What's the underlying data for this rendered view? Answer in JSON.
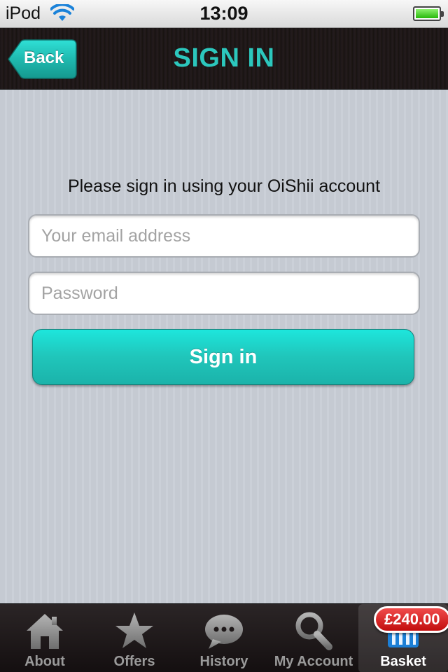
{
  "status_bar": {
    "carrier": "iPod",
    "time": "13:09"
  },
  "nav": {
    "back_label": "Back",
    "title": "SIGN IN"
  },
  "form": {
    "instruction": "Please sign in using your OiShii account",
    "email_placeholder": "Your email address",
    "email_value": "",
    "password_placeholder": "Password",
    "password_value": "",
    "submit_label": "Sign in"
  },
  "tabs": [
    {
      "label": "About",
      "icon": "home-icon"
    },
    {
      "label": "Offers",
      "icon": "star-icon"
    },
    {
      "label": "History",
      "icon": "speech-bubble-icon"
    },
    {
      "label": "My Account",
      "icon": "search-icon"
    },
    {
      "label": "Basket",
      "icon": "basket-icon",
      "selected": true
    }
  ],
  "basket_badge": "£240.00",
  "colors": {
    "accent": "#2cc7bd",
    "button": "#1fc9be",
    "badge": "#d61a1a",
    "background": "#c7ccd4"
  }
}
